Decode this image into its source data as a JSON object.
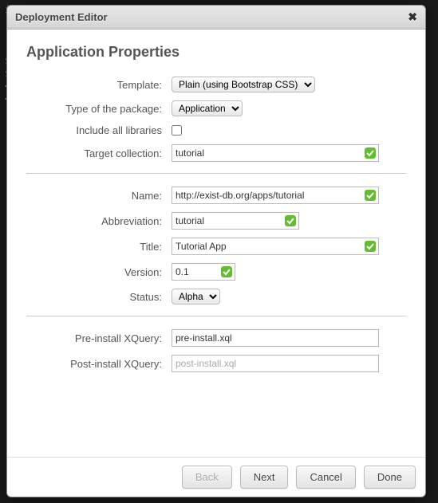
{
  "dialog": {
    "title": "Deployment Editor",
    "heading": "Application Properties"
  },
  "labels": {
    "template": "Template:",
    "type_of_package": "Type of the package:",
    "include_all_libraries": "Include all libraries",
    "target_collection": "Target collection:",
    "name": "Name:",
    "abbreviation": "Abbreviation:",
    "title": "Title:",
    "version": "Version:",
    "status": "Status:",
    "pre_install": "Pre-install XQuery:",
    "post_install": "Post-install XQuery:"
  },
  "fields": {
    "template_options": [
      "Plain (using Bootstrap CSS)"
    ],
    "template_value": "Plain (using Bootstrap CSS)",
    "type_options": [
      "Application"
    ],
    "type_value": "Application",
    "include_all_libraries": false,
    "target_collection": "tutorial",
    "name": "http://exist-db.org/apps/tutorial",
    "abbreviation": "tutorial",
    "title": "Tutorial App",
    "version": "0.1",
    "status_options": [
      "Alpha"
    ],
    "status_value": "Alpha",
    "pre_install": "pre-install.xql",
    "post_install": "",
    "post_install_placeholder": "post-install.xql"
  },
  "buttons": {
    "back": "Back",
    "next": "Next",
    "cancel": "Cancel",
    "done": "Done"
  }
}
